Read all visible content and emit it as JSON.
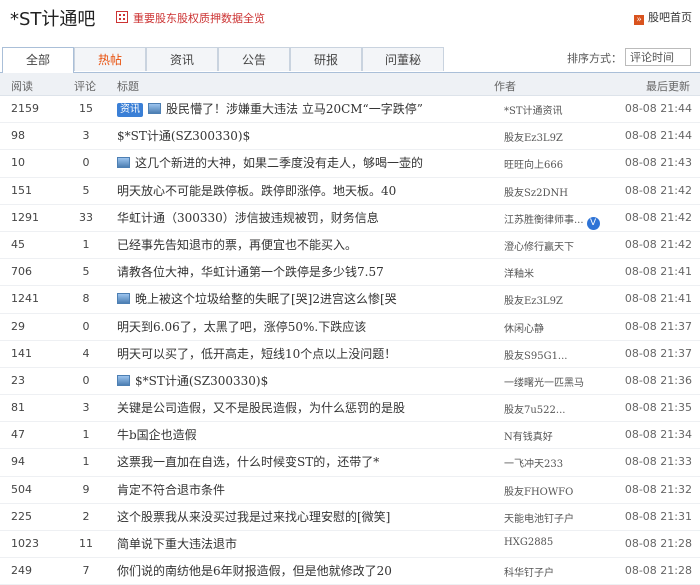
{
  "header": {
    "title": "*ST计通吧",
    "notice": "重要股东股权质押数据全览",
    "home_label": "股吧首页"
  },
  "tabs": [
    "全部",
    "热帖",
    "资讯",
    "公告",
    "研报",
    "问董秘"
  ],
  "sort": {
    "label": "排序方式：",
    "value": "评论时间"
  },
  "columns": {
    "read": "阅读",
    "comments": "评论",
    "title": "标题",
    "author": "作者",
    "updated": "最后更新"
  },
  "rows": [
    {
      "read": "2159",
      "comments": "15",
      "tag": "资讯",
      "img": true,
      "title": "股民懵了！涉嫌重大违法 立马20CM“一字跌停”",
      "author": "*ST计通资讯",
      "time": "08-08 21:44"
    },
    {
      "read": "98",
      "comments": "3",
      "tag": "",
      "img": false,
      "title": "$*ST计通(SZ300330)$",
      "author": "股友Ez3L9Z",
      "time": "08-08 21:44"
    },
    {
      "read": "10",
      "comments": "0",
      "tag": "",
      "img": true,
      "title": "这几个新进的大神，如果二季度没有走人，够喝一壶的",
      "author": "旺旺向上666",
      "time": "08-08 21:43"
    },
    {
      "read": "151",
      "comments": "5",
      "tag": "",
      "img": false,
      "title": "明天放心不可能是跌停板。跌停即涨停。地天板。40",
      "author": "股友Sz2DNH",
      "time": "08-08 21:42"
    },
    {
      "read": "1291",
      "comments": "33",
      "tag": "",
      "img": false,
      "title": "华虹计通（300330）涉信披违规被罚，财务信息",
      "author": "江苏胜衡律师事...",
      "verified": true,
      "time": "08-08 21:42"
    },
    {
      "read": "45",
      "comments": "1",
      "tag": "",
      "img": false,
      "title": "已经事先告知退市的票，再便宜也不能买入。",
      "author": "澄心修行赢天下",
      "time": "08-08 21:42"
    },
    {
      "read": "706",
      "comments": "5",
      "tag": "",
      "img": false,
      "title": "请教各位大神，华虹计通第一个跌停是多少钱7.57",
      "author": "洋釉米",
      "time": "08-08 21:41"
    },
    {
      "read": "1241",
      "comments": "8",
      "tag": "",
      "img": true,
      "title": "晚上被这个垃圾给整的失眠了[哭]2进宫这么惨[哭",
      "author": "股友Ez3L9Z",
      "time": "08-08 21:41"
    },
    {
      "read": "29",
      "comments": "0",
      "tag": "",
      "img": false,
      "title": "明天到6.06了，太黑了吧，涨停50%.下跌应该",
      "author": "休闲心静",
      "time": "08-08 21:37"
    },
    {
      "read": "141",
      "comments": "4",
      "tag": "",
      "img": false,
      "title": "明天可以买了，低开高走，短线10个点以上没问题！",
      "author": "股友S95G1...",
      "time": "08-08 21:37"
    },
    {
      "read": "23",
      "comments": "0",
      "tag": "",
      "img": true,
      "title": "$*ST计通(SZ300330)$",
      "author": "一缕曙光一匹黑马",
      "time": "08-08 21:36"
    },
    {
      "read": "81",
      "comments": "3",
      "tag": "",
      "img": false,
      "title": "关键是公司造假，又不是股民造假，为什么惩罚的是股",
      "author": "股友7u522...",
      "time": "08-08 21:35"
    },
    {
      "read": "47",
      "comments": "1",
      "tag": "",
      "img": false,
      "title": "牛b国企也造假",
      "author": "N有钱真好",
      "time": "08-08 21:34"
    },
    {
      "read": "94",
      "comments": "1",
      "tag": "",
      "img": false,
      "title": "这票我一直加在自选，什么时候变ST的，还带了*",
      "author": "一飞冲天233",
      "time": "08-08 21:33"
    },
    {
      "read": "504",
      "comments": "9",
      "tag": "",
      "img": false,
      "title": "肯定不符合退市条件",
      "author": "股友FHOWFO",
      "time": "08-08 21:32"
    },
    {
      "read": "225",
      "comments": "2",
      "tag": "",
      "img": false,
      "title": "这个股票我从来没买过我是过来找心理安慰的[微笑]",
      "author": "天能电池钉子户",
      "time": "08-08 21:31"
    },
    {
      "read": "1023",
      "comments": "11",
      "tag": "",
      "img": false,
      "title": "简单说下重大违法退市",
      "author": "HXG2885",
      "time": "08-08 21:28"
    },
    {
      "read": "249",
      "comments": "7",
      "tag": "",
      "img": false,
      "title": "你们说的南纺他是6年财报造假，但是他就修改了20",
      "author": "科华钉子户",
      "time": "08-08 21:28"
    }
  ]
}
